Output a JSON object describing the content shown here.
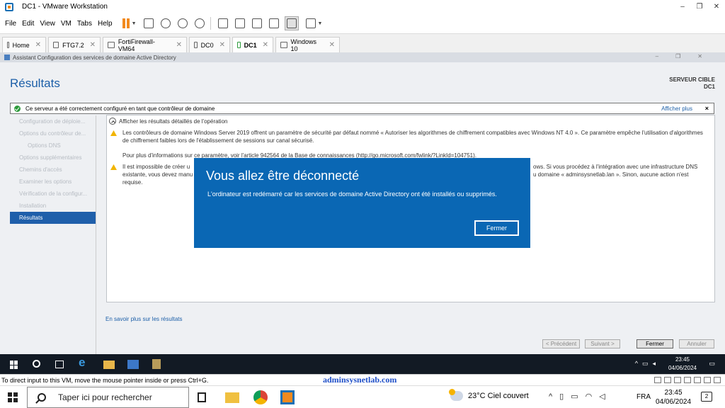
{
  "window": {
    "title": "DC1 - VMware Workstation",
    "controls": [
      "–",
      "❐",
      "✕"
    ]
  },
  "menu": [
    "File",
    "Edit",
    "View",
    "VM",
    "Tabs",
    "Help"
  ],
  "tabs": [
    {
      "label": "Home",
      "active": false
    },
    {
      "label": "FTG7.2",
      "active": false
    },
    {
      "label": "FortiFirewall-VM64",
      "active": false
    },
    {
      "label": "DC0",
      "active": false
    },
    {
      "label": "DC1",
      "active": true
    },
    {
      "label": "Windows 10",
      "active": false
    }
  ],
  "wizard": {
    "window_title": "Assistant Configuration des services de domaine Active Directory",
    "heading": "Résultats",
    "target_label": "SERVEUR CIBLE",
    "target_name": "DC1",
    "banner_text": "Ce serveur a été correctement configuré en tant que contrôleur de domaine",
    "banner_more": "Afficher plus",
    "banner_close": "×",
    "nav": [
      {
        "label": "Configuration de déploie...",
        "sub": false,
        "selected": false
      },
      {
        "label": "Options du contrôleur de...",
        "sub": false,
        "selected": false
      },
      {
        "label": "Options DNS",
        "sub": true,
        "selected": false
      },
      {
        "label": "Options supplémentaires",
        "sub": false,
        "selected": false
      },
      {
        "label": "Chemins d'accès",
        "sub": false,
        "selected": false
      },
      {
        "label": "Examiner les options",
        "sub": false,
        "selected": false
      },
      {
        "label": "Vérification de la configur...",
        "sub": false,
        "selected": false
      },
      {
        "label": "Installation",
        "sub": false,
        "selected": false
      },
      {
        "label": "Résultats",
        "sub": false,
        "selected": true
      }
    ],
    "details_header": "Afficher les résultats détaillés de l'opération",
    "warning1_a": "Les contrôleurs de domaine Windows Server 2019 offrent un paramètre de sécurité par défaut nommé « Autoriser les algorithmes de chiffrement compatibles avec Windows NT 4.0 ». Ce paramètre empêche l'utilisation d'algorithmes de chiffrement faibles lors de l'établissement de sessions sur canal sécurisé.",
    "warning1_b": "Pour plus d'informations sur ce paramètre, voir l'article 942564 de la Base de connaissances (http://go.microsoft.com/fwlink/?LinkId=104751).",
    "warning2_left": "Il est impossible de créer u",
    "warning2_left2": "existante, vous devez manu",
    "warning2_left3": "requise.",
    "warning2_right": "ows. Si vous procédez à l'intégration avec une infrastructure DNS",
    "warning2_right2": "u domaine « adminsysnetlab.lan ». Sinon, aucune action n'est",
    "learn_more": "En savoir plus sur les résultats",
    "buttons": {
      "prev": "< Précédent",
      "next": "Suivant >",
      "close": "Fermer",
      "cancel": "Annuler"
    }
  },
  "modal": {
    "title": "Vous allez être déconnecté",
    "body": "L'ordinateur est redémarré car les services de domaine Active Directory ont été installés ou supprimés.",
    "button": "Fermer",
    "color": "#0a67b4"
  },
  "guest_taskbar": {
    "time": "23:45",
    "date": "04/06/2024"
  },
  "status": {
    "hint": "To direct input to this VM, move the mouse pointer inside or press Ctrl+G.",
    "watermark": "adminsysnetlab.com"
  },
  "host_taskbar": {
    "search_placeholder": "Taper ici pour rechercher",
    "weather": "23°C  Ciel couvert",
    "lang": "FRA",
    "time": "23:45",
    "date": "04/06/2024",
    "notifications": "2"
  }
}
